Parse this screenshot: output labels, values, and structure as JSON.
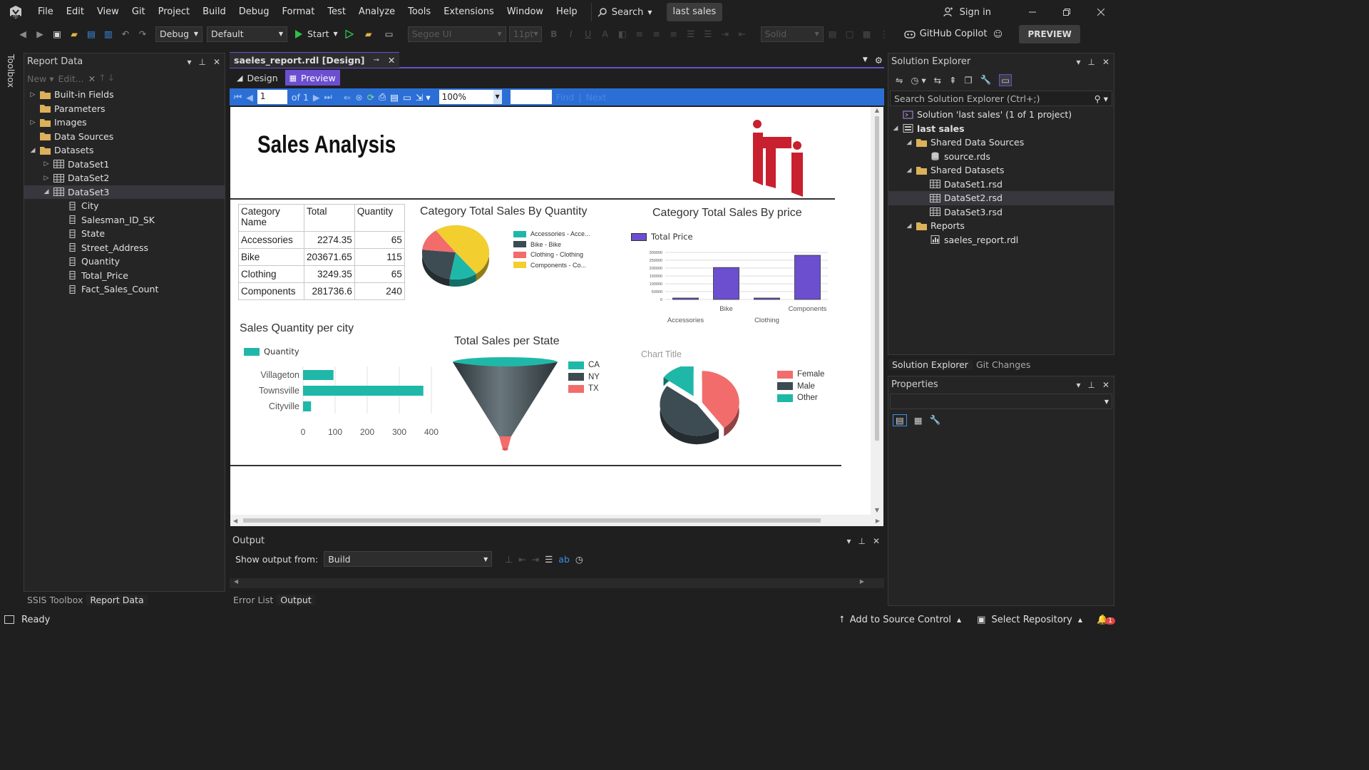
{
  "menubar": {
    "items": [
      "File",
      "Edit",
      "View",
      "Git",
      "Project",
      "Build",
      "Debug",
      "Format",
      "Test",
      "Analyze",
      "Tools",
      "Extensions",
      "Window",
      "Help"
    ],
    "search_label": "Search",
    "solution_name": "last sales",
    "sign_in": "Sign in"
  },
  "toolbar": {
    "config": "Debug",
    "platform": "Default",
    "start": "Start",
    "font": "Segoe UI",
    "size": "11pt",
    "border": "Solid",
    "copilot": "GitHub Copilot",
    "preview": "PREVIEW"
  },
  "toolbox_label": "Toolbox",
  "report_data": {
    "title": "Report Data",
    "new_label": "New",
    "edit_label": "Edit...",
    "tree": [
      {
        "label": "Built-in Fields",
        "level": 0,
        "arrow": "right",
        "icon": "folder"
      },
      {
        "label": "Parameters",
        "level": 0,
        "arrow": "",
        "icon": "folder"
      },
      {
        "label": "Images",
        "level": 0,
        "arrow": "right",
        "icon": "folder"
      },
      {
        "label": "Data Sources",
        "level": 0,
        "arrow": "",
        "icon": "folder"
      },
      {
        "label": "Datasets",
        "level": 0,
        "arrow": "down",
        "icon": "folder"
      },
      {
        "label": "DataSet1",
        "level": 1,
        "arrow": "right",
        "icon": "table"
      },
      {
        "label": "DataSet2",
        "level": 1,
        "arrow": "right",
        "icon": "table"
      },
      {
        "label": "DataSet3",
        "level": 1,
        "arrow": "down",
        "icon": "table",
        "selected": true
      },
      {
        "label": "City",
        "level": 2,
        "arrow": "",
        "icon": "field"
      },
      {
        "label": "Salesman_ID_SK",
        "level": 2,
        "arrow": "",
        "icon": "field"
      },
      {
        "label": "State",
        "level": 2,
        "arrow": "",
        "icon": "field"
      },
      {
        "label": "Street_Address",
        "level": 2,
        "arrow": "",
        "icon": "field"
      },
      {
        "label": "Quantity",
        "level": 2,
        "arrow": "",
        "icon": "field"
      },
      {
        "label": "Total_Price",
        "level": 2,
        "arrow": "",
        "icon": "field"
      },
      {
        "label": "Fact_Sales_Count",
        "level": 2,
        "arrow": "",
        "icon": "field"
      }
    ],
    "bottom_tabs": [
      "SSIS Toolbox",
      "Report Data"
    ]
  },
  "document": {
    "tab_title": "saeles_report.rdl [Design]",
    "design_tab": "Design",
    "preview_tab": "Preview",
    "page_number": "1",
    "page_of": "of",
    "page_total": "1",
    "zoom": "100%",
    "find_label": "Find",
    "next_label": "Next"
  },
  "report": {
    "title": "Sales Analysis",
    "logo_text": "iti",
    "table": {
      "headers": [
        "Category Name",
        "Total",
        "Quantity"
      ],
      "rows": [
        [
          "Accessories",
          "2274.35",
          "65"
        ],
        [
          "Bike",
          "203671.65",
          "115"
        ],
        [
          "Clothing",
          "3249.35",
          "65"
        ],
        [
          "Components",
          "281736.6",
          "240"
        ]
      ]
    }
  },
  "chart_data": [
    {
      "type": "pie",
      "title": "Category Total Sales By Quantity",
      "categories": [
        "Accessories - Acce...",
        "Bike - Bike",
        "Clothing - Clothing",
        "Components - Co..."
      ],
      "values": [
        65,
        115,
        65,
        240
      ],
      "colors": [
        "#1fb8a8",
        "#3d4b52",
        "#f26c6c",
        "#f2cf2f"
      ]
    },
    {
      "type": "bar",
      "title": "Category Total Sales By price",
      "categories": [
        "Accessories",
        "Bike",
        "Clothing",
        "Components"
      ],
      "series": [
        {
          "name": "Total Price",
          "values": [
            2274.35,
            203671.65,
            3249.35,
            281736.6
          ],
          "color": "#6b4fcf"
        }
      ],
      "ylim": [
        0,
        300000
      ],
      "yticks": [
        "300000",
        "250000",
        "200000",
        "150000",
        "100000",
        "50000",
        "0"
      ],
      "grid": true,
      "legend": "top-left"
    },
    {
      "type": "bar",
      "orientation": "horizontal",
      "title": "Sales Quantity per city",
      "categories": [
        "Villageton",
        "Townsville",
        "Cityville"
      ],
      "series": [
        {
          "name": "Quantity",
          "values": [
            95,
            375,
            25
          ],
          "color": "#1fb8a8"
        }
      ],
      "xlim": [
        0,
        400
      ],
      "xticks": [
        "0",
        "100",
        "200",
        "300",
        "400"
      ],
      "legend": "top-left"
    },
    {
      "type": "funnel",
      "title": "Total Sales per State",
      "categories": [
        "CA",
        "NY",
        "TX"
      ],
      "colors": [
        "#1fb8a8",
        "#3d4b52",
        "#f26c6c"
      ],
      "legend": "right"
    },
    {
      "type": "pie",
      "title": "Chart Title",
      "categories": [
        "Female",
        "Male",
        "Other"
      ],
      "values": [
        40,
        45,
        15
      ],
      "colors": [
        "#f26c6c",
        "#3d4b52",
        "#1fb8a8"
      ],
      "legend": "right"
    }
  ],
  "output": {
    "title": "Output",
    "show_from_label": "Show output from:",
    "source": "Build",
    "tabs": [
      "Error List",
      "Output"
    ]
  },
  "solution_explorer": {
    "title": "Solution Explorer",
    "search_placeholder": "Search Solution Explorer (Ctrl+;)",
    "tree": [
      {
        "label": "Solution 'last sales' (1 of 1 project)",
        "level": 0,
        "arrow": "",
        "icon": "solution"
      },
      {
        "label": "last sales",
        "level": 0,
        "arrow": "down",
        "icon": "project",
        "bold": true
      },
      {
        "label": "Shared Data Sources",
        "level": 1,
        "arrow": "down",
        "icon": "folder"
      },
      {
        "label": "source.rds",
        "level": 2,
        "arrow": "",
        "icon": "db"
      },
      {
        "label": "Shared Datasets",
        "level": 1,
        "arrow": "down",
        "icon": "folder"
      },
      {
        "label": "DataSet1.rsd",
        "level": 2,
        "arrow": "",
        "icon": "table"
      },
      {
        "label": "DataSet2.rsd",
        "level": 2,
        "arrow": "",
        "icon": "table",
        "selected": true
      },
      {
        "label": "DataSet3.rsd",
        "level": 2,
        "arrow": "",
        "icon": "table"
      },
      {
        "label": "Reports",
        "level": 1,
        "arrow": "down",
        "icon": "folder"
      },
      {
        "label": "saeles_report.rdl",
        "level": 2,
        "arrow": "",
        "icon": "report"
      }
    ],
    "tabs": [
      "Solution Explorer",
      "Git Changes"
    ]
  },
  "properties": {
    "title": "Properties"
  },
  "statusbar": {
    "ready": "Ready",
    "source_control": "Add to Source Control",
    "repository": "Select Repository",
    "notifications": "1"
  },
  "colors": {
    "accent": "#6b4fcf",
    "teal": "#1fb8a8",
    "dark_slate": "#3d4b52",
    "coral": "#f26c6c",
    "yellow": "#f2cf2f",
    "report_toolbar": "#2b6fd6"
  }
}
